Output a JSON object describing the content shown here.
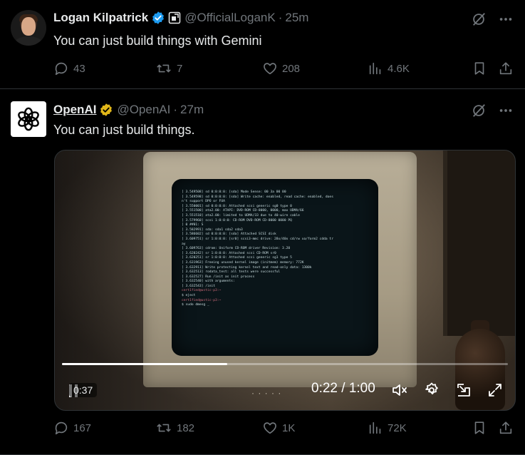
{
  "tweets": [
    {
      "name": "Logan Kilpatrick",
      "handle": "@OfficialLoganK",
      "dot": "·",
      "time": "25m",
      "text": "You can just build things with Gemini",
      "verified_color": "#1d9bf0",
      "avatar_icon": "person-avatar",
      "affiliation_icon": "affiliate-badge-icon",
      "stats": {
        "replies": "43",
        "reposts": "7",
        "likes": "208",
        "views": "4.6K"
      }
    },
    {
      "name": "OpenAI",
      "handle": "@OpenAI",
      "dot": "·",
      "time": "27m",
      "text": "You can just build things.",
      "verified_color": "#e2b719",
      "avatar_icon": "openai-logo",
      "video": {
        "elapsed_badge": "0:37",
        "time_readout": "0:22 / 1:00",
        "progress": 0.37,
        "terminal_lines": [
          "[  3.549508] sd 0:0:0:0: [sda] Mode Sense: 00 3a 00 00",
          "[  3.549598] sd 0:0:0:0: [sda] Write cache: enabled, read cache: enabled, does",
          "n't support DPO or FUA",
          "[  3.550001] sd 0:0:0:0: Attached scsi generic sg0 type 0",
          "[  3.551500] ata2.00: ATAPI: DVD-ROM CD-8000, 0000, max UDMA/66",
          "[  3.551510] ata2.00: limited to UDMA/33 due to 40-wire cable",
          "[  3.579960] scsi 1:0:0:0: CD-ROM             DVD-ROM CD-8000   0000 PQ",
          "[ 0 ##01: S",
          "[  3.582991]  sda: sda1 sda2 sda3",
          "[  3.586602] sd 0:0:0:0: [sda] Attached SCSI disk",
          "[  3.609751] sr 1:0:0:0: [sr0] scsi3-mmc drive: 28x/40x cd/rw xa/form2 cdda tr",
          "ay",
          "[  3.609763] cdrom: Uniform CD-ROM driver Revision: 3.20",
          "[  3.620242] sr 1:0:0:0: Attached scsi CD-ROM sr0",
          "[  3.620251] sr 1:0:0:0: Attached scsi generic sg1 type 5",
          "[  3.631963] Freeing unused kernel image (initmem) memory: 772K",
          "[  3.632911] Write protecting kernel text and read-only data: 1300k",
          "[  3.632513] rodata_test: all tests were successful",
          "[  3.632527] Run /init as init process",
          "[  3.632540]   with arguments:",
          "[  3.632543]     /init",
          "cert1fied@ustic-p3:~",
          "$ eject",
          "cert1fied@ustic-p3:~",
          "$ sudo dmesg _"
        ]
      },
      "stats": {
        "replies": "167",
        "reposts": "182",
        "likes": "1K",
        "views": "72K"
      }
    }
  ]
}
